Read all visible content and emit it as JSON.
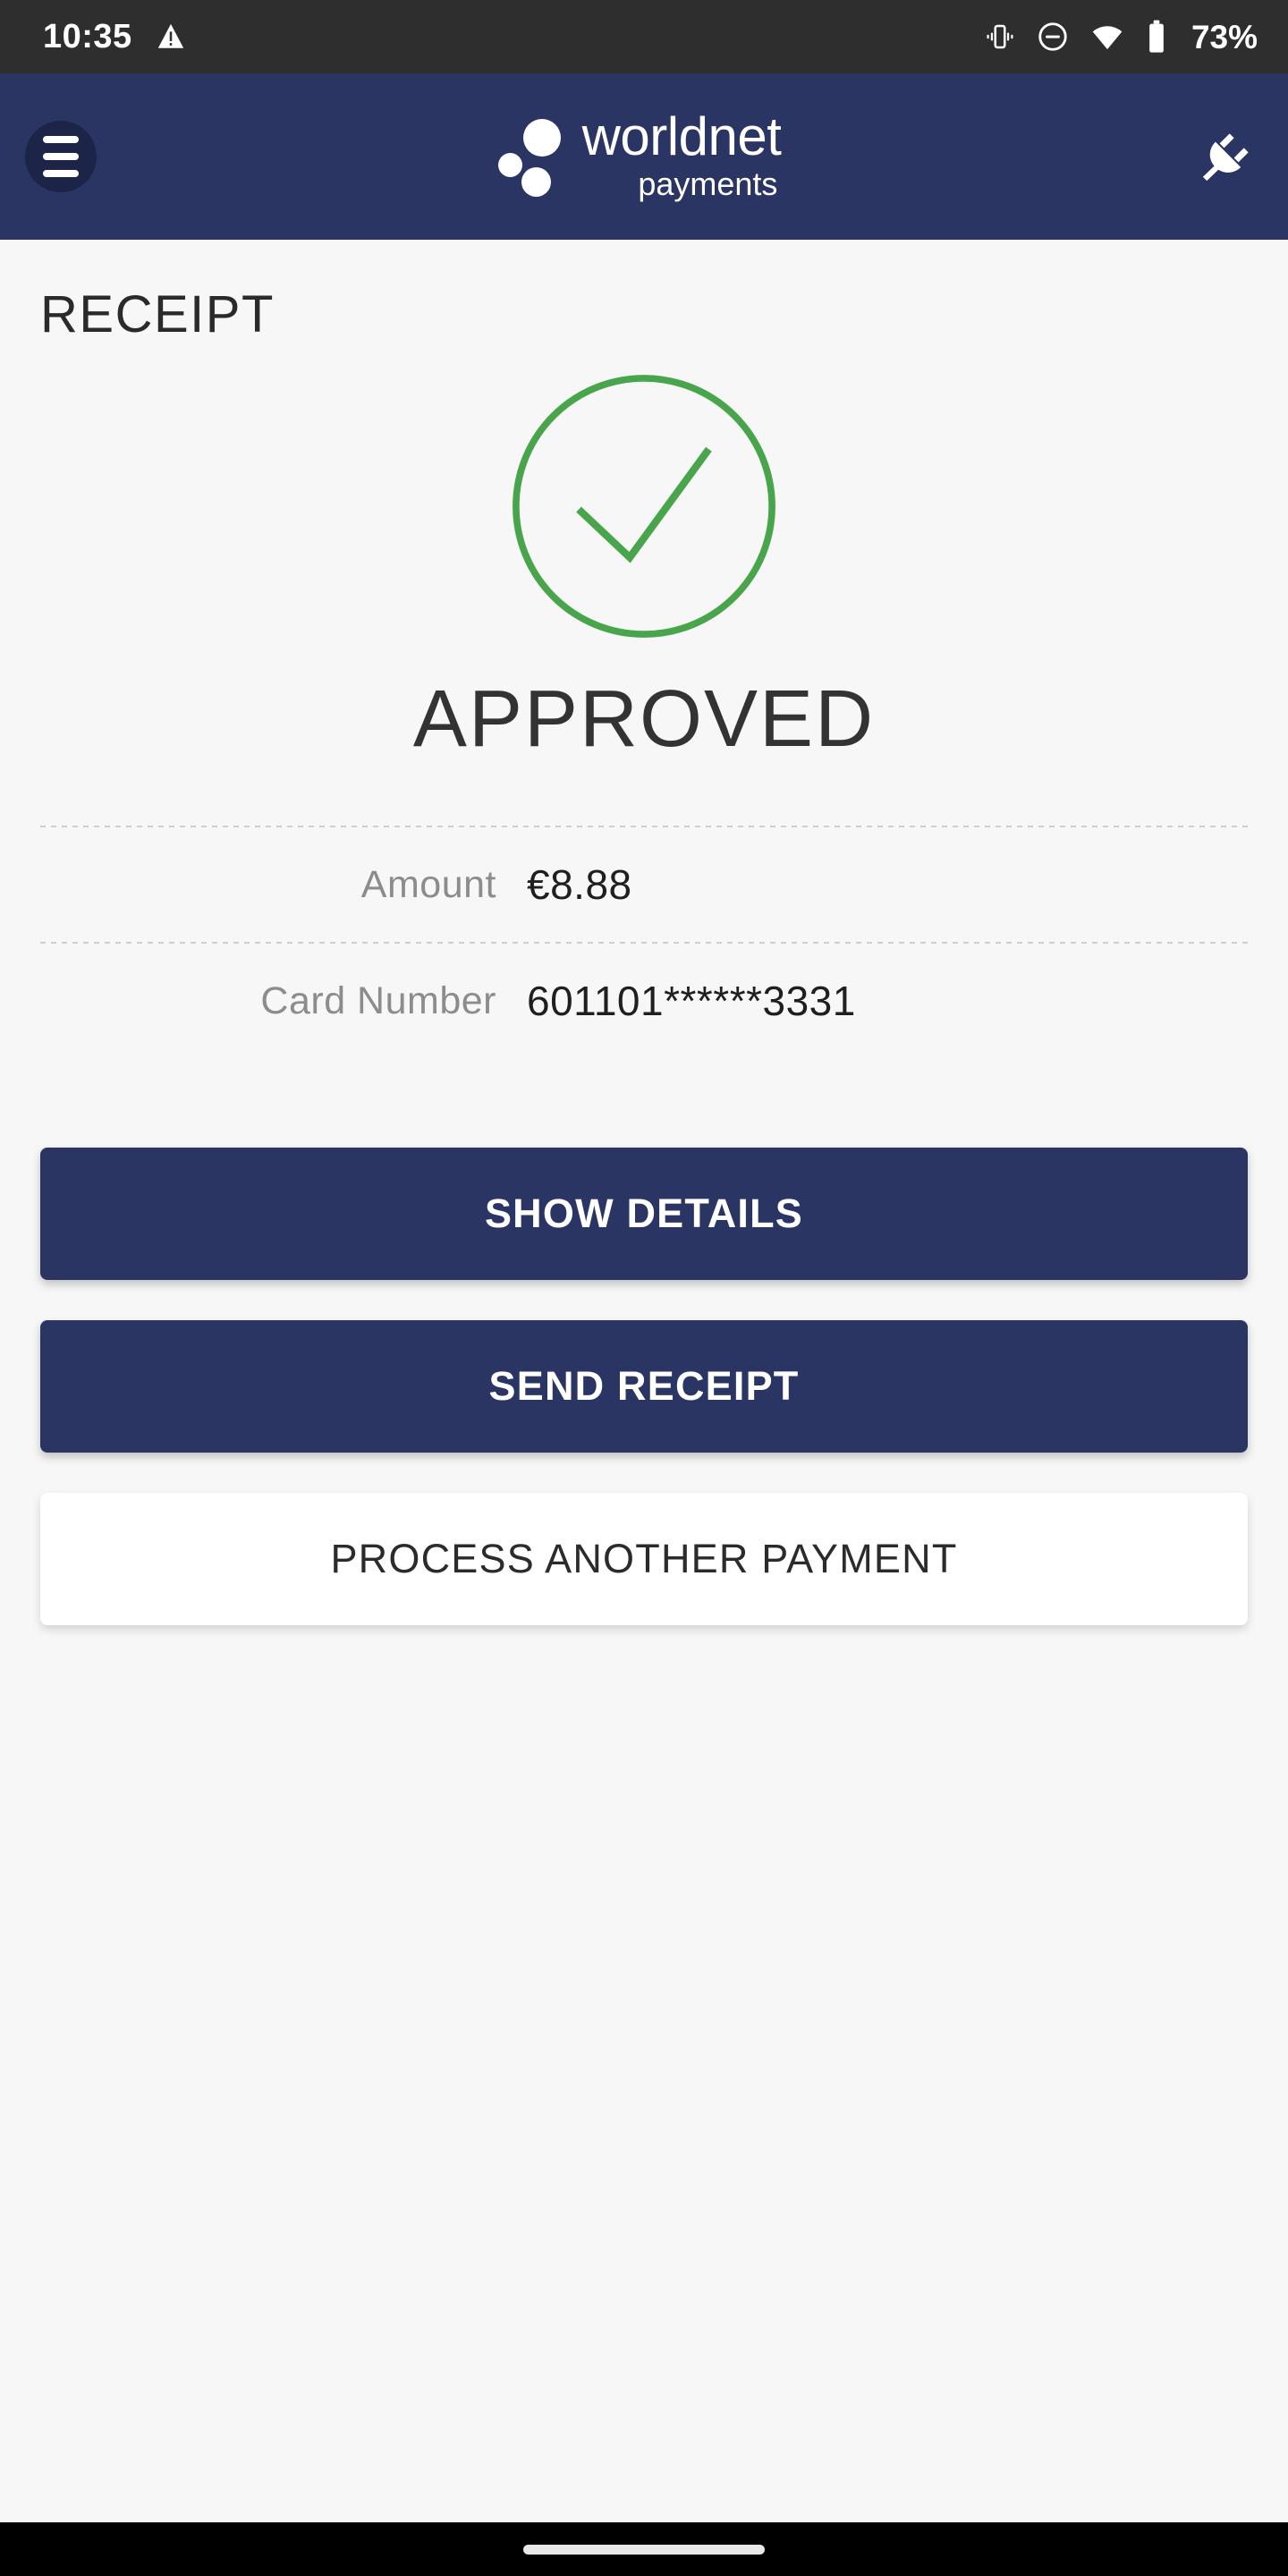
{
  "status_bar": {
    "time": "10:35",
    "warning_icon": "warning-triangle-icon",
    "vibrate_icon": "vibrate-icon",
    "dnd_icon": "do-not-disturb-icon",
    "wifi_icon": "wifi-icon",
    "battery_icon": "battery-icon",
    "battery_percent": "73%"
  },
  "header": {
    "menu_icon": "hamburger-menu-icon",
    "logo_main": "worldnet",
    "logo_sub": "payments",
    "plug_icon": "power-plug-icon",
    "background_color": "#2b3564"
  },
  "main": {
    "page_title": "RECEIPT",
    "status": {
      "icon": "check-circle-icon",
      "label": "APPROVED",
      "color": "#49a54b"
    },
    "details": [
      {
        "label": "Amount",
        "value": "€8.88"
      },
      {
        "label": "Card Number",
        "value": "601101******3331"
      }
    ],
    "buttons": [
      {
        "label": "SHOW DETAILS",
        "style": "primary"
      },
      {
        "label": "SEND RECEIPT",
        "style": "primary"
      },
      {
        "label": "PROCESS ANOTHER PAYMENT",
        "style": "secondary"
      }
    ]
  },
  "nav_bar": {
    "home_indicator": "home-gesture-pill"
  }
}
